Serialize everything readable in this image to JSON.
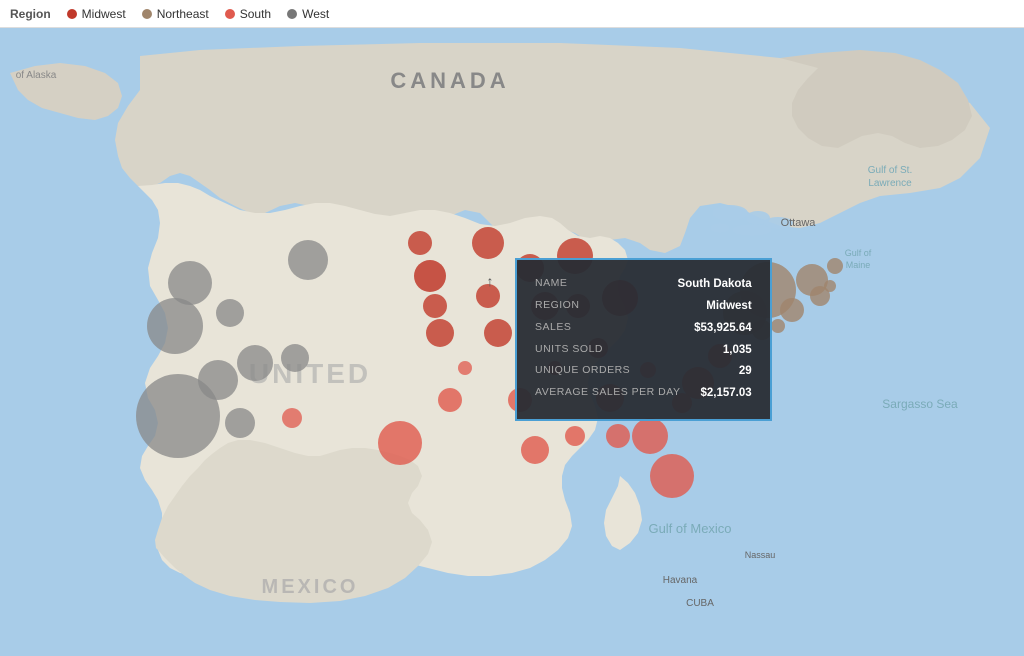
{
  "legend": {
    "title": "Region",
    "items": [
      {
        "label": "Midwest",
        "color": "#c0392b",
        "dotColor": "#c0392b"
      },
      {
        "label": "Northeast",
        "color": "#a0856b",
        "dotColor": "#a0856b"
      },
      {
        "label": "South",
        "color": "#e05a4e",
        "dotColor": "#e05a4e"
      },
      {
        "label": "West",
        "color": "#777",
        "dotColor": "#777"
      }
    ]
  },
  "tooltip": {
    "name_label": "NAME",
    "name_value": "South Dakota",
    "region_label": "REGION",
    "region_value": "Midwest",
    "sales_label": "SALES",
    "sales_value": "$53,925.64",
    "units_label": "UNITS SOLD",
    "units_value": "1,035",
    "orders_label": "UNIQUE ORDERS",
    "orders_value": "29",
    "avg_label": "AVERAGE SALES PER DAY",
    "avg_value": "$2,157.03"
  },
  "map": {
    "land_color": "#e8e4d8",
    "water_color": "#a8cce8",
    "canada_label": "CANADA",
    "us_label": "UNITED",
    "mexico_label": "MEXICO",
    "alaska_label": "of Alaska",
    "gulf_mexico_label": "Gulf of Mexico",
    "sargasso_label": "Sargasso Sea",
    "ottawa_label": "Ottawa"
  },
  "bubbles": {
    "midwest_color": "#c0392b",
    "northeast_color": "#a0856b",
    "south_color": "#e05a4e",
    "west_color": "#888"
  }
}
